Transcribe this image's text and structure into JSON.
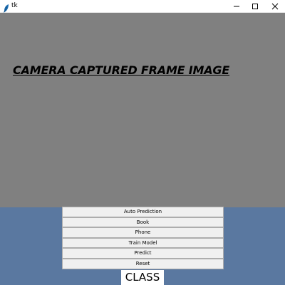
{
  "window": {
    "title": "tk",
    "controls": {
      "minimize_icon": "minimize-icon",
      "maximize_icon": "maximize-icon",
      "close_icon": "close-icon"
    }
  },
  "frame": {
    "label": "CAMERA CAPTURED FRAME IMAGE",
    "background": "#808080"
  },
  "buttons": [
    {
      "label": "Auto Prediction"
    },
    {
      "label": "Book"
    },
    {
      "label": "Phone"
    },
    {
      "label": "Train Model"
    },
    {
      "label": "Predict"
    },
    {
      "label": "Reset"
    }
  ],
  "class_label": "CLASS",
  "colors": {
    "window_bg": "#5a78a0",
    "button_bg": "#f0f0f0"
  }
}
